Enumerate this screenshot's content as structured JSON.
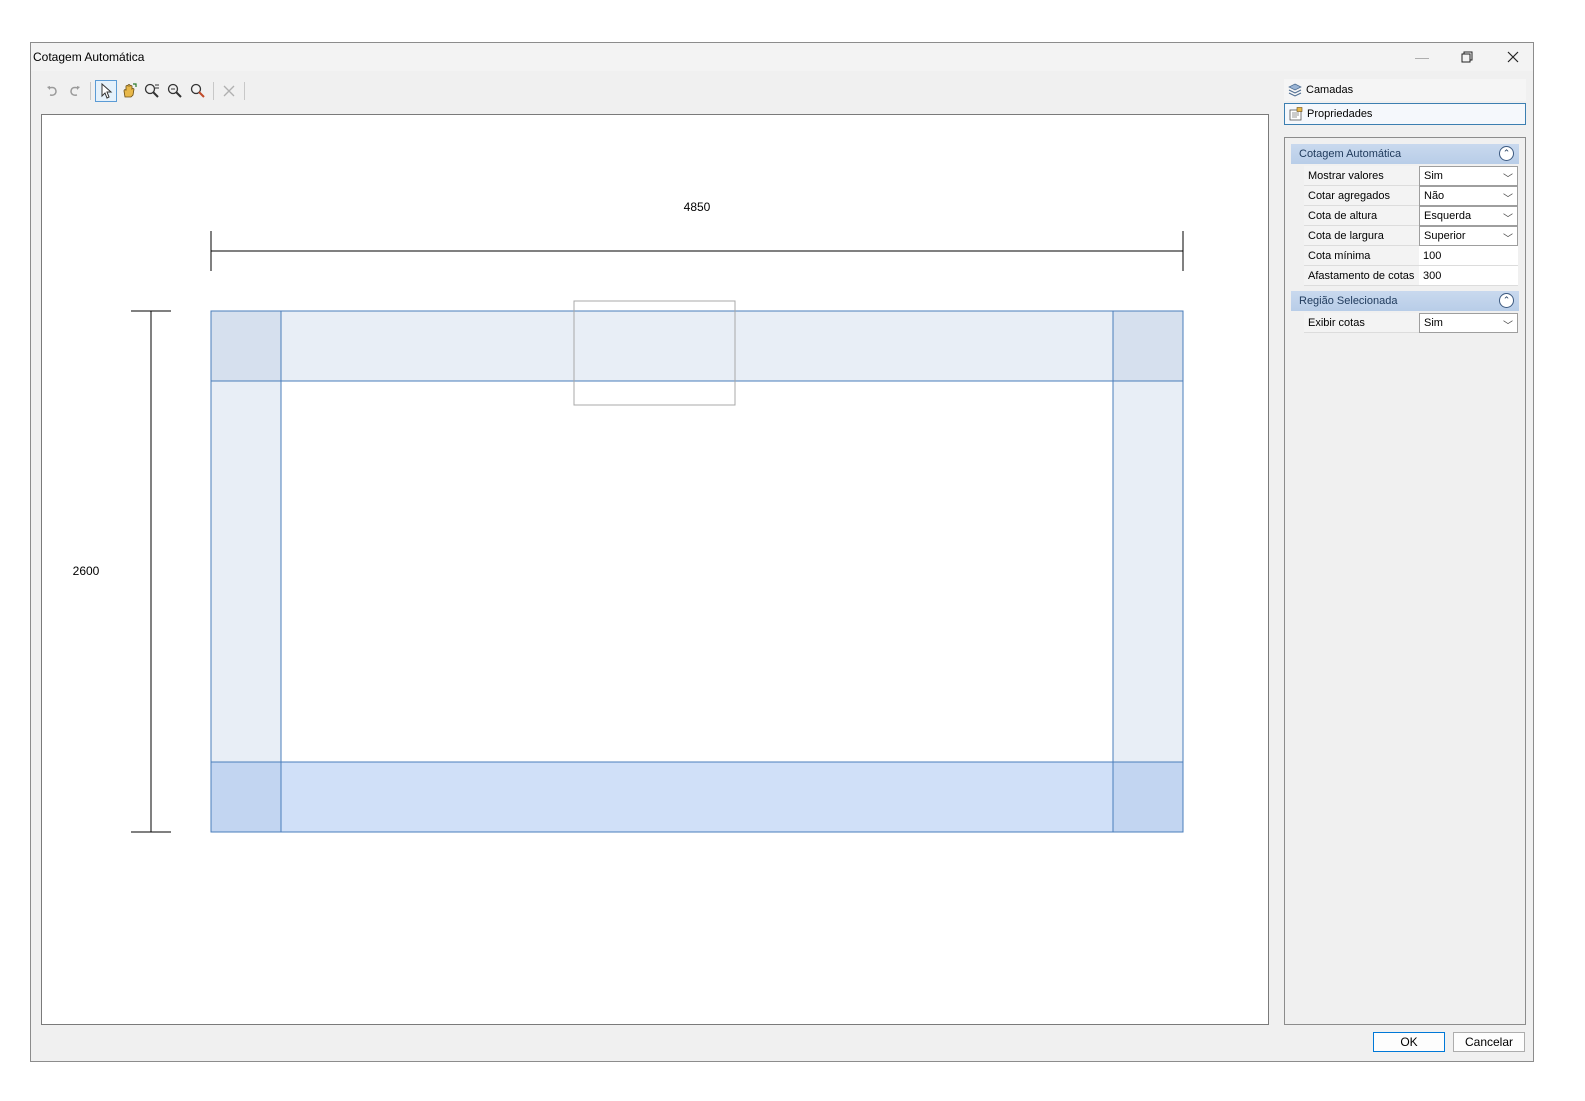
{
  "window": {
    "title": "Cotagem Automática"
  },
  "toolbar": {
    "tools": [
      "undo-icon",
      "redo-icon",
      "select-pointer-icon",
      "pan-hand-icon",
      "zoom-window-icon",
      "zoom-out-icon",
      "zoom-extents-icon",
      "delete-icon"
    ]
  },
  "drawing": {
    "width_dim": "4850",
    "height_dim": "2600"
  },
  "panel": {
    "tabs": [
      {
        "label": "Camadas",
        "icon": "layers-icon"
      },
      {
        "label": "Propriedades",
        "icon": "properties-icon"
      }
    ],
    "categories": [
      {
        "title": "Cotagem Automática",
        "rows": [
          {
            "name": "Mostrar valores",
            "value": "Sim"
          },
          {
            "name": "Cotar agregados",
            "value": "Não"
          },
          {
            "name": "Cota de altura",
            "value": "Esquerda"
          },
          {
            "name": "Cota de largura",
            "value": "Superior"
          },
          {
            "name": "Cota mínima",
            "value": "100"
          },
          {
            "name": "Afastamento de cotas",
            "value": "300"
          }
        ]
      },
      {
        "title": "Região Selecionada",
        "rows": [
          {
            "name": "Exibir cotas",
            "value": "Sim"
          }
        ]
      }
    ]
  },
  "buttons": {
    "ok": "OK",
    "cancel": "Cancelar"
  },
  "colors": {
    "accent": "#0078d7",
    "frame_stroke": "#4a7ebb",
    "frame_light": "#e8eef6",
    "frame_bottom": "#d0e0f8"
  }
}
